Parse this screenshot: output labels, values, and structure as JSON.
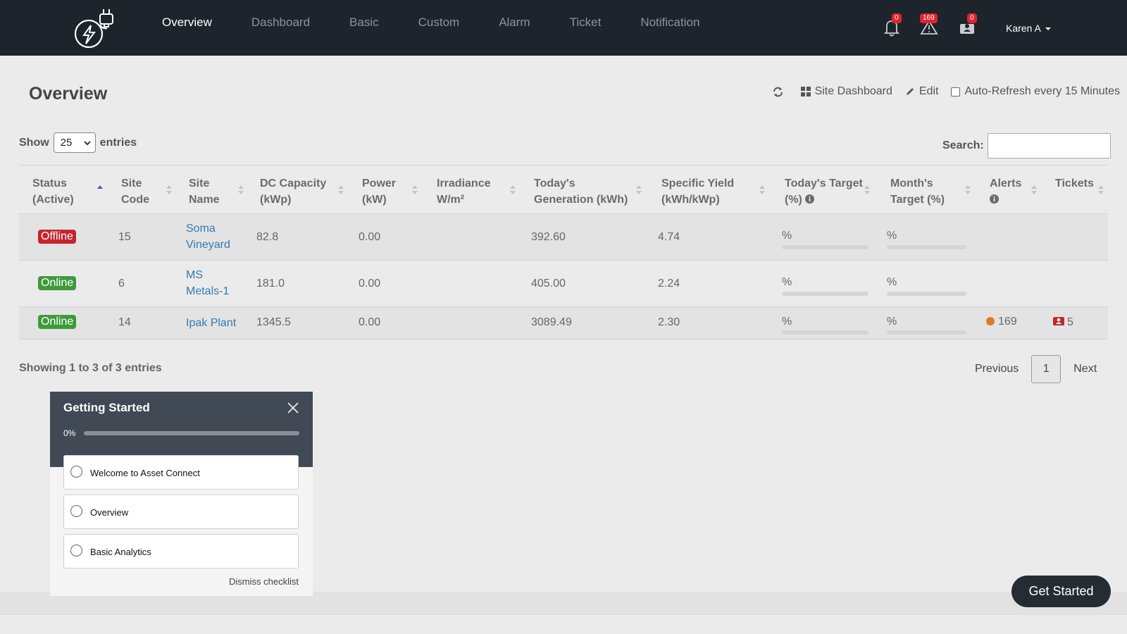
{
  "nav": {
    "items": [
      {
        "label": "Overview",
        "active": true
      },
      {
        "label": "Dashboard"
      },
      {
        "label": "Basic"
      },
      {
        "label": "Custom"
      },
      {
        "label": "Alarm"
      },
      {
        "label": "Ticket"
      },
      {
        "label": "Notification"
      }
    ],
    "badges": {
      "bell": "0",
      "alerts": "169",
      "tickets": "0"
    },
    "user": "Karen A"
  },
  "page": {
    "title": "Overview",
    "toolbar": {
      "site_dashboard": "Site Dashboard",
      "edit": "Edit",
      "auto_refresh": "Auto-Refresh every 15 Minutes"
    }
  },
  "controls": {
    "show_label": "Show",
    "entries_value": "25",
    "entries_label": "entries",
    "search_label": "Search:"
  },
  "table": {
    "headers": [
      {
        "line1": "Status",
        "line2": "(Active)"
      },
      {
        "line1": "Site",
        "line2": "Code"
      },
      {
        "line1": "Site",
        "line2": "Name"
      },
      {
        "line1": "DC Capacity",
        "line2": "(kWp)"
      },
      {
        "line1": "Power",
        "line2": "(kW)"
      },
      {
        "line1": "Irradiance",
        "line2": "W/m²"
      },
      {
        "line1": "Today's",
        "line2": "Generation (kWh)"
      },
      {
        "line1": "Specific Yield",
        "line2": "(kWh/kWp)"
      },
      {
        "line1": "Today's Target",
        "line2": "(%)"
      },
      {
        "line1": "Month's",
        "line2": "Target (%)"
      },
      {
        "line1": "Alerts",
        "line2": ""
      },
      {
        "line1": "Tickets",
        "line2": ""
      }
    ],
    "rows": [
      {
        "status": "Offline",
        "code": "15",
        "name_line1": "Soma",
        "name_line2": "Vineyard",
        "dc": "82.8",
        "power": "0.00",
        "irradiance": "",
        "generation": "392.60",
        "yield": "4.74",
        "today_target": "%",
        "month_target": "%",
        "alerts": "",
        "tickets": ""
      },
      {
        "status": "Online",
        "code": "6",
        "name_line1": "MS",
        "name_line2": "Metals-1",
        "dc": "181.0",
        "power": "0.00",
        "irradiance": "",
        "generation": "405.00",
        "yield": "2.24",
        "today_target": "%",
        "month_target": "%",
        "alerts": "",
        "tickets": ""
      },
      {
        "status": "Online",
        "code": "14",
        "name_line1": "Ipak Plant",
        "name_line2": "",
        "dc": "1345.5",
        "power": "0.00",
        "irradiance": "",
        "generation": "3089.49",
        "yield": "2.30",
        "today_target": "%",
        "month_target": "%",
        "alerts": "169",
        "tickets": "5"
      }
    ]
  },
  "footer": {
    "showing": "Showing 1 to 3 of 3 entries",
    "previous": "Previous",
    "page": "1",
    "next": "Next"
  },
  "getting_started": {
    "title": "Getting Started",
    "progress": "0%",
    "items": [
      "Welcome to Asset Connect",
      "Overview",
      "Basic Analytics"
    ],
    "dismiss": "Dismiss checklist",
    "button": "Get Started"
  }
}
